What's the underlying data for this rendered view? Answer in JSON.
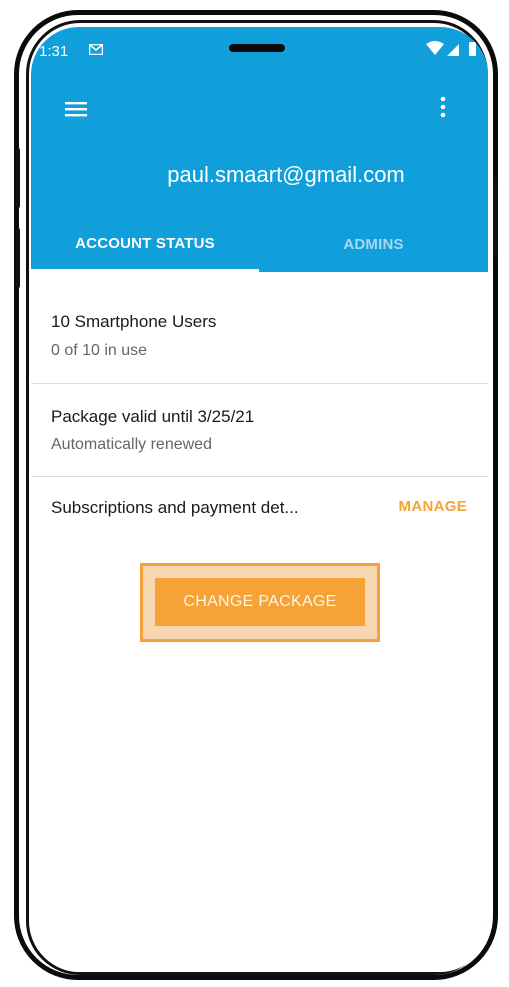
{
  "status_bar": {
    "time": "1:31"
  },
  "header": {
    "email": "paul.smaart@gmail.com"
  },
  "tabs": [
    {
      "label": "ACCOUNT STATUS",
      "active": true
    },
    {
      "label": "ADMINS",
      "active": false
    }
  ],
  "account": {
    "users_title": "10 Smartphone Users",
    "users_subtitle": "0 of 10 in use",
    "package_title": "Package valid until 3/25/21",
    "package_subtitle": "Automatically renewed",
    "subscriptions_label": "Subscriptions and payment det...",
    "manage_label": "MANAGE",
    "change_package_label": "CHANGE PACKAGE"
  },
  "colors": {
    "app_bar": "#119fdc",
    "accent_orange": "#f5a236",
    "inactive_tab": "#a6d8f2"
  },
  "icons": [
    "mail-icon",
    "wifi-icon",
    "signal-icon",
    "battery-icon",
    "menu-icon",
    "more-vert-icon"
  ]
}
